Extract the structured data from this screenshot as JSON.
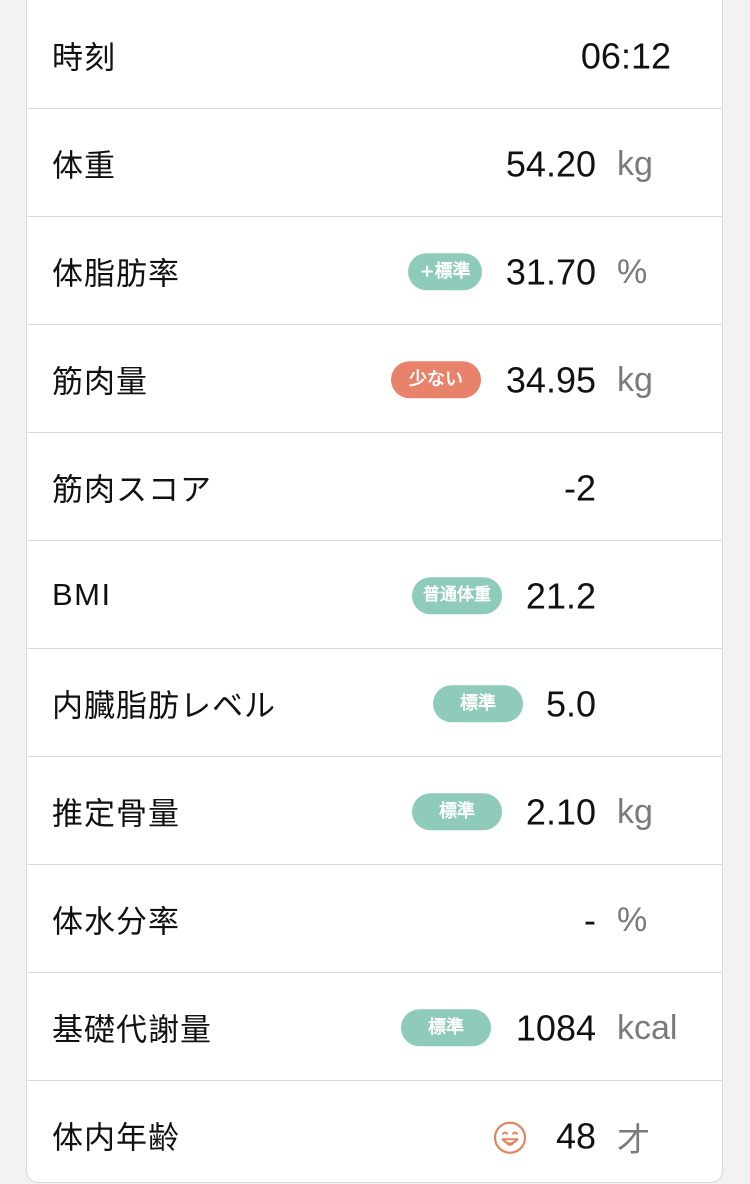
{
  "rows": [
    {
      "label": "時刻",
      "value": "06:12",
      "unit": "",
      "badge": ""
    },
    {
      "label": "体重",
      "value": "54.20",
      "unit": "kg",
      "badge": ""
    },
    {
      "label": "体脂肪率",
      "value": "31.70",
      "unit": "%",
      "badge": "+標準"
    },
    {
      "label": "筋肉量",
      "value": "34.95",
      "unit": "kg",
      "badge": "少ない"
    },
    {
      "label": "筋肉スコア",
      "value": "-2",
      "unit": "",
      "badge": ""
    },
    {
      "label": "BMI",
      "value": "21.2",
      "unit": "",
      "badge": "普通体重"
    },
    {
      "label": "内臓脂肪レベル",
      "value": "5.0",
      "unit": "",
      "badge": "標準"
    },
    {
      "label": "推定骨量",
      "value": "2.10",
      "unit": "kg",
      "badge": "標準"
    },
    {
      "label": "体水分率",
      "value": "-",
      "unit": "%",
      "badge": ""
    },
    {
      "label": "基礎代謝量",
      "value": "1084",
      "unit": "kcal",
      "badge": "標準"
    },
    {
      "label": "体内年齢",
      "value": "48",
      "unit": "才",
      "badge": "",
      "icon": "smiling-face-icon"
    }
  ],
  "colors": {
    "badge_normal": "#8ecbbb",
    "badge_low": "#e9826b",
    "face_icon": "#e1845f",
    "unit": "#7a7a7a"
  }
}
